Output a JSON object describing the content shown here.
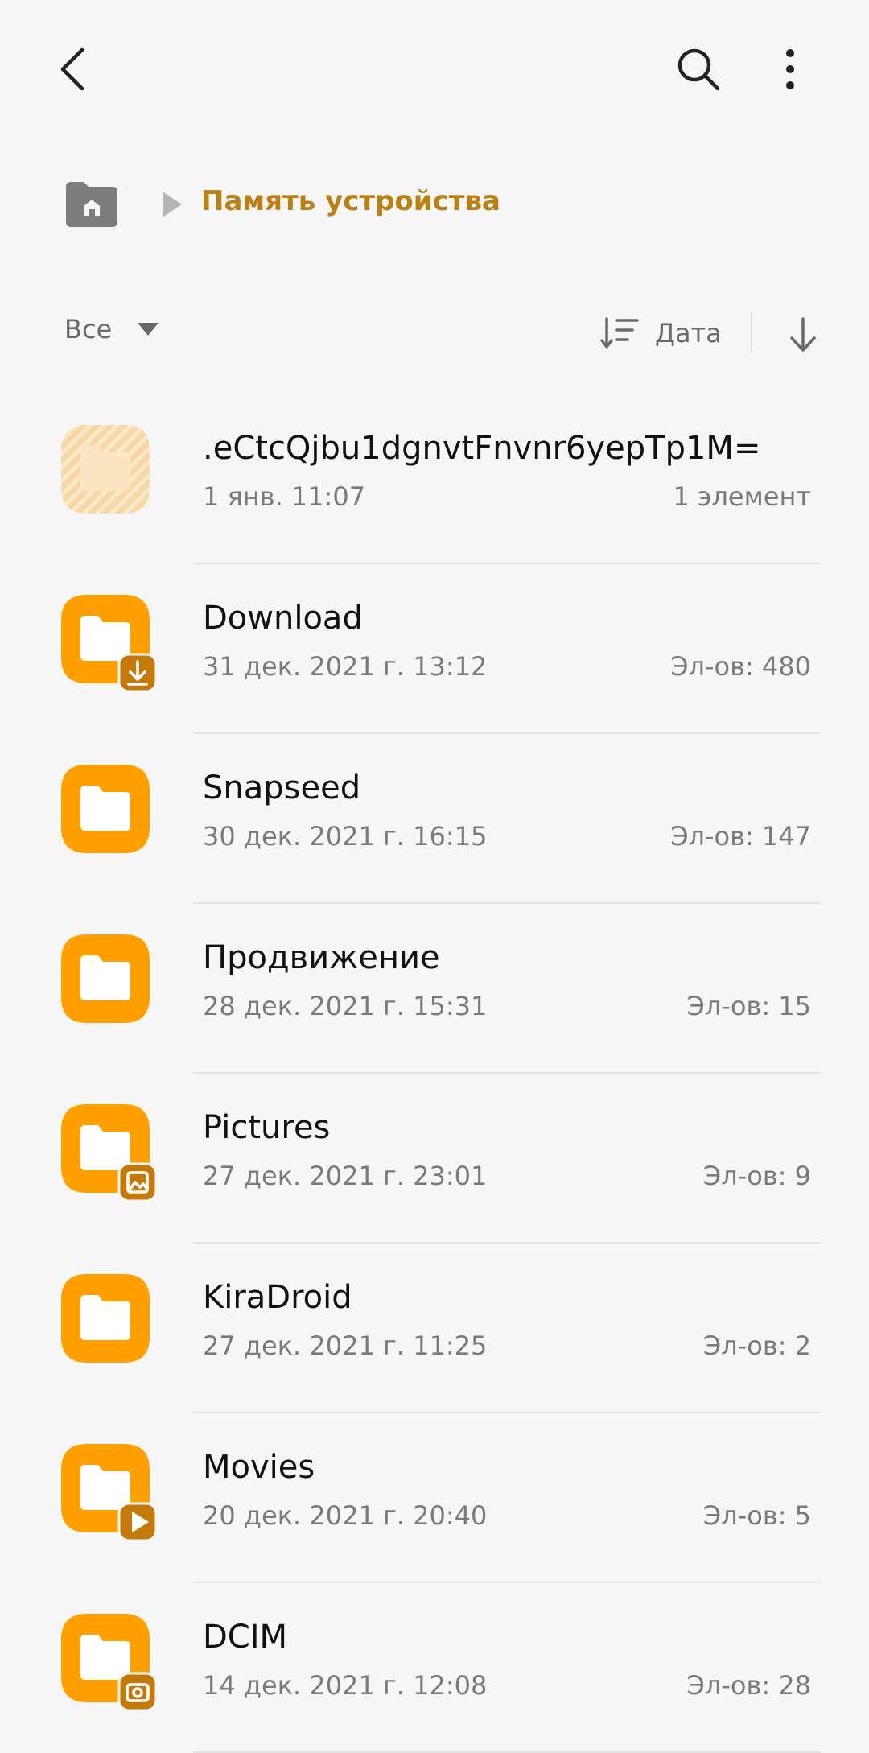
{
  "breadcrumb": {
    "current": "Память устройства"
  },
  "filter": {
    "type_label": "Все",
    "sort_label": "Дата"
  },
  "colors": {
    "folder": "#ffa000",
    "folder_hidden": "#f7d8a4",
    "badge": "#c47a08",
    "accent_text": "#b98015"
  },
  "files": [
    {
      "name": ".eCtcQjbu1dgnvtFnvnr6yepTp1M=",
      "date": "1 янв. 11:07",
      "count": "1 элемент",
      "badge": "none",
      "hidden": true
    },
    {
      "name": "Download",
      "date": "31 дек. 2021 г. 13:12",
      "count": "Эл-ов: 480",
      "badge": "download",
      "hidden": false
    },
    {
      "name": "Snapseed",
      "date": "30 дек. 2021 г. 16:15",
      "count": "Эл-ов: 147",
      "badge": "none",
      "hidden": false
    },
    {
      "name": "Продвижение",
      "date": "28 дек. 2021 г. 15:31",
      "count": "Эл-ов: 15",
      "badge": "none",
      "hidden": false
    },
    {
      "name": "Pictures",
      "date": "27 дек. 2021 г. 23:01",
      "count": "Эл-ов: 9",
      "badge": "image",
      "hidden": false
    },
    {
      "name": "KiraDroid",
      "date": "27 дек. 2021 г. 11:25",
      "count": "Эл-ов: 2",
      "badge": "none",
      "hidden": false
    },
    {
      "name": "Movies",
      "date": "20 дек. 2021 г. 20:40",
      "count": "Эл-ов: 5",
      "badge": "play",
      "hidden": false
    },
    {
      "name": "DCIM",
      "date": "14 дек. 2021 г. 12:08",
      "count": "Эл-ов: 28",
      "badge": "camera",
      "hidden": false
    }
  ]
}
